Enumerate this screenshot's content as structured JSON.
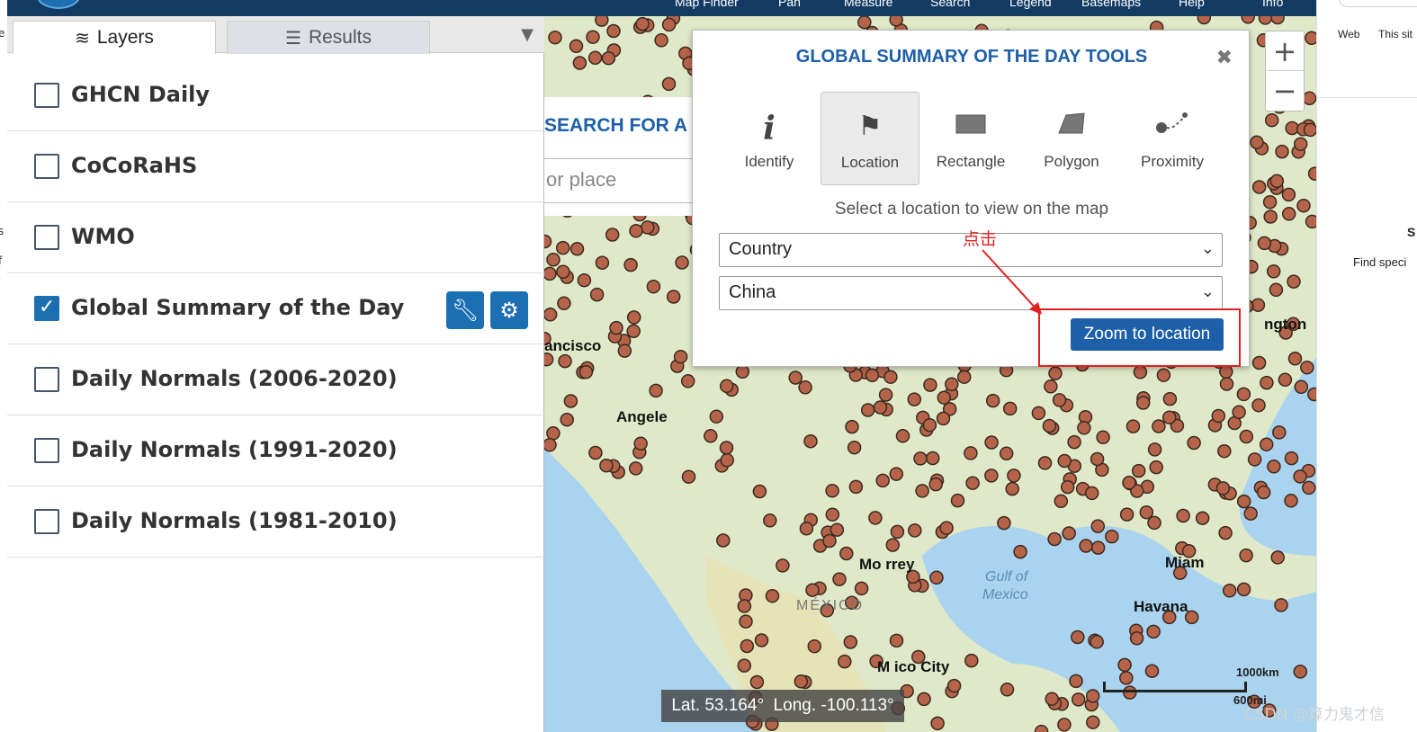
{
  "topbar": {
    "nav": [
      "Map Finder",
      "Pan",
      "Measure",
      "Search",
      "Legend",
      "Basemaps",
      "Help",
      "Info"
    ]
  },
  "external_right": {
    "options": [
      "Web",
      "This sit"
    ],
    "find_text": "Find speci",
    "letter": "S"
  },
  "panel": {
    "tabs": [
      {
        "label": "Layers",
        "icon": "layers-icon"
      },
      {
        "label": "Results",
        "icon": "list-icon"
      }
    ],
    "layers": [
      {
        "label": "GHCN Daily",
        "checked": false
      },
      {
        "label": "CoCoRaHS",
        "checked": false
      },
      {
        "label": "WMO",
        "checked": false
      },
      {
        "label": "Global Summary of the Day",
        "checked": true
      },
      {
        "label": "Daily Normals (2006-2020)",
        "checked": false
      },
      {
        "label": "Daily Normals (1991-2020)",
        "checked": false
      },
      {
        "label": "Daily Normals (1981-2010)",
        "checked": false
      }
    ]
  },
  "search": {
    "title": "SEARCH FOR A L",
    "placeholder": "or place"
  },
  "dialog": {
    "title": "GLOBAL SUMMARY OF THE DAY TOOLS",
    "tools": [
      {
        "label": "Identify",
        "icon": "info-icon"
      },
      {
        "label": "Location",
        "icon": "flag-icon"
      },
      {
        "label": "Rectangle",
        "icon": "rectangle-icon"
      },
      {
        "label": "Polygon",
        "icon": "polygon-icon"
      },
      {
        "label": "Proximity",
        "icon": "proximity-icon"
      }
    ],
    "selected_tool": "Location",
    "instruction": "Select a location to view on the map",
    "select_type": "Country",
    "select_value": "China",
    "zoom_button": "Zoom to location"
  },
  "annotation": {
    "text": "点击",
    "color": "#e02020"
  },
  "map": {
    "labels": [
      "ancisco",
      "Angele",
      "Mo  rrey",
      "Gulf of",
      "Mexico",
      "MÉXICO",
      "M  ico City",
      "Havana",
      "ngton",
      "Miam"
    ],
    "coords": "Lat. 53.164°  Long. -100.113°",
    "scale_km": "1000km",
    "scale_mi": "600mi",
    "station_color": "#b5644a"
  },
  "watermark": "CSDN @算力鬼才信"
}
